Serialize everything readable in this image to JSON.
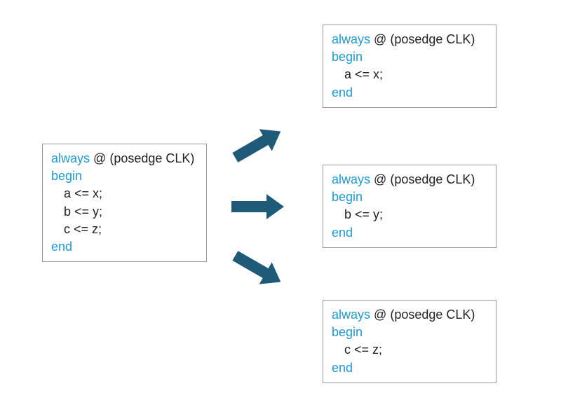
{
  "colors": {
    "keyword": "#1e9bd1",
    "text": "#222222",
    "arrow_fill": "#1f5a78",
    "box_border": "#999999"
  },
  "keywords": {
    "always": "always",
    "at": "@",
    "sensitivity": "(posedge CLK)",
    "begin": "begin",
    "end": "end"
  },
  "left_box": {
    "lines": [
      "a <= x;",
      "b <= y;",
      "c <= z;"
    ]
  },
  "right_boxes": [
    {
      "line": "a <= x;"
    },
    {
      "line": "b <= y;"
    },
    {
      "line": "c <= z;"
    }
  ],
  "arrows": [
    {
      "direction": "up-right"
    },
    {
      "direction": "right"
    },
    {
      "direction": "down-right"
    }
  ]
}
